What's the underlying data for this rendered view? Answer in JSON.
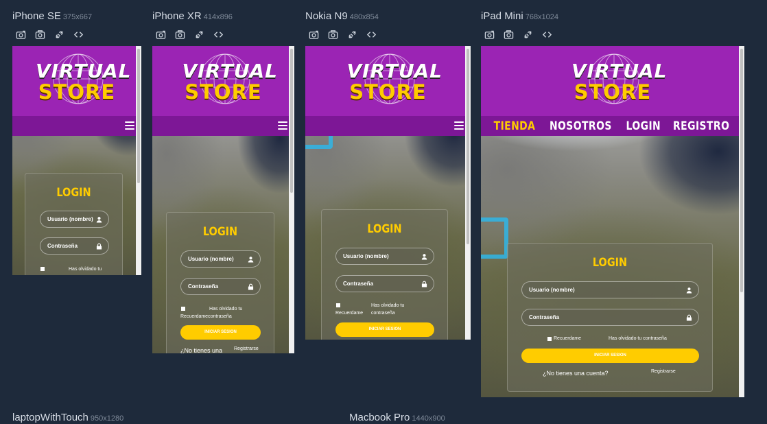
{
  "brand": {
    "line1": "VIRTUAL",
    "line2": "STORE"
  },
  "login": {
    "title": "LOGIN",
    "username_placeholder": "Usuario (nombre)",
    "password_placeholder": "Contraseña",
    "remember": "Recuerdame",
    "forgot": "Has olvidado tu contraseña",
    "forgot_line1": "Has olvidado tu",
    "forgot_line2": "contraseña",
    "submit": "INICIAR SESION",
    "no_account": "¿No tienes una cuenta?",
    "no_account_short": "¿No tienes una",
    "register_link": "Registrarse",
    "xr_remember_joined": "Recuerdamecontraseña"
  },
  "nav": {
    "items": [
      "TIENDA",
      "NOSOTROS",
      "LOGIN",
      "REGISTRO"
    ],
    "active": "TIENDA"
  },
  "devices": [
    {
      "name": "iPhone SE",
      "size": "375x667"
    },
    {
      "name": "iPhone XR",
      "size": "414x896"
    },
    {
      "name": "Nokia N9",
      "size": "480x854"
    },
    {
      "name": "iPad Mini",
      "size": "768x1024"
    },
    {
      "name": "laptopWithTouch",
      "size": "950x1280"
    },
    {
      "name": "Macbook Pro",
      "size": "1440x900"
    }
  ],
  "tools": {
    "icons": [
      "camera-rotate-icon",
      "camera-icon",
      "plug-icon",
      "code-icon"
    ]
  },
  "colors": {
    "background": "#1e2a3b",
    "header": "#9b24b4",
    "navbar": "#7d1796",
    "accent": "#ffcc00"
  }
}
